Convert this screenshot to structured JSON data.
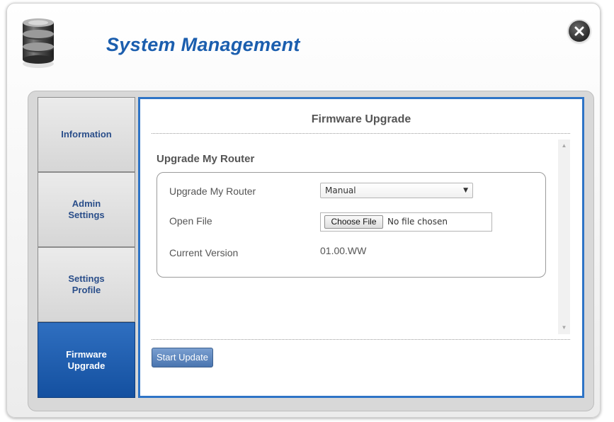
{
  "header": {
    "title": "System Management",
    "icon": "database-icon",
    "close_icon": "close-icon"
  },
  "sidebar": {
    "items": [
      {
        "label": "Information",
        "active": false
      },
      {
        "label": "Admin\nSettings",
        "active": false
      },
      {
        "label": "Settings\nProfile",
        "active": false
      },
      {
        "label": "Firmware\nUpgrade",
        "active": true
      }
    ]
  },
  "main": {
    "title": "Firmware Upgrade",
    "section_title": "Upgrade My Router",
    "rows": {
      "upgrade_mode": {
        "label": "Upgrade My Router",
        "value": "Manual"
      },
      "open_file": {
        "label": "Open File",
        "button_label": "Choose File",
        "file_status": "No file chosen"
      },
      "current_version": {
        "label": "Current Version",
        "value": "01.00.WW"
      }
    },
    "start_button": "Start Update"
  },
  "colors": {
    "accent": "#2e74c6",
    "title": "#1b5eae",
    "active_tab": "#1450a0"
  }
}
